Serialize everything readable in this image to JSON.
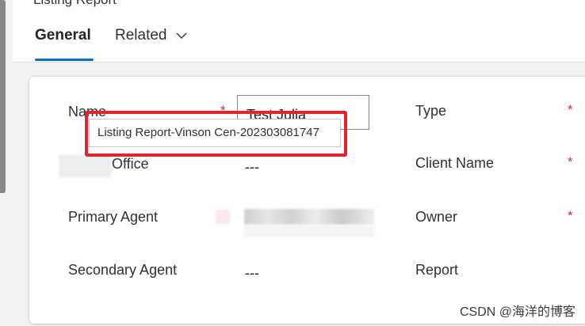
{
  "record_title": "Listing Report",
  "tabs": [
    {
      "label": "General",
      "selected": true
    },
    {
      "label": "Related",
      "selected": false
    }
  ],
  "colors": {
    "accent": "#0f6cbd",
    "required": "#c4314b",
    "highlight": "#e3242b"
  },
  "form": {
    "name": {
      "label": "Name",
      "value": "Test Julia"
    },
    "office": {
      "label": "Office",
      "value": "---"
    },
    "primary_agent": {
      "label": "Primary Agent"
    },
    "secondary_agent": {
      "label": "Secondary Agent",
      "value": "---"
    },
    "type": {
      "label": "Type"
    },
    "client_name": {
      "label": "Client Name"
    },
    "owner": {
      "label": "Owner"
    },
    "report": {
      "label": "Report"
    },
    "required_marker": "*"
  },
  "tooltip": {
    "text": "Listing Report-Vinson Cen-202303081747"
  },
  "icons": {
    "related_chevron": "chevron-down-icon"
  },
  "watermark": "CSDN @海洋的博客"
}
